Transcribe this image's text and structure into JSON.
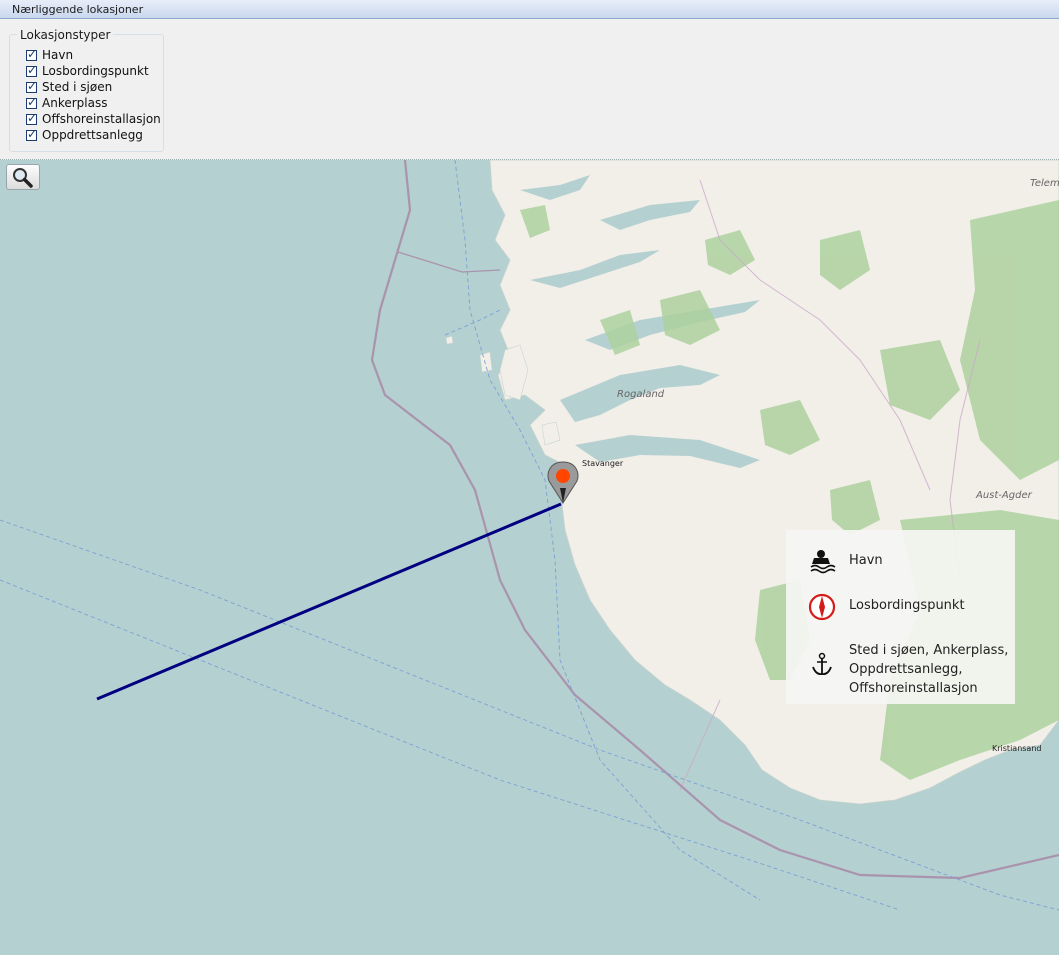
{
  "window": {
    "title": "Nærliggende lokasjoner"
  },
  "filter": {
    "group_label": "Lokasjonstyper",
    "items": [
      {
        "label": "Havn",
        "checked": true
      },
      {
        "label": "Losbordingspunkt",
        "checked": true
      },
      {
        "label": "Sted i sjøen",
        "checked": true
      },
      {
        "label": "Ankerplass",
        "checked": true
      },
      {
        "label": "Offshoreinstallasjon",
        "checked": true
      },
      {
        "label": "Oppdrettsanlegg",
        "checked": true
      }
    ]
  },
  "map": {
    "zoom_icon": "magnifier-icon",
    "labels": {
      "region_1": "Rogaland",
      "region_2": "Aust-Agder",
      "region_3": "Telem",
      "city_1": "Stavanger",
      "city_2": "Kristiansand"
    },
    "colors": {
      "sea": "#b5d0d0",
      "land": "#f2efe9",
      "forest": "#add19e",
      "route_line": "#000080",
      "marker": "#ff4500"
    }
  },
  "legend": {
    "items": [
      {
        "icon": "harbor-icon",
        "label": "Havn"
      },
      {
        "icon": "compass-icon",
        "label": "Losbordingspunkt"
      },
      {
        "icon": "anchor-icon",
        "label_lines": [
          "Sted i sjøen, Ankerplass,",
          "Oppdrettsanlegg,",
          "Offshoreinstallasjon"
        ]
      }
    ]
  }
}
